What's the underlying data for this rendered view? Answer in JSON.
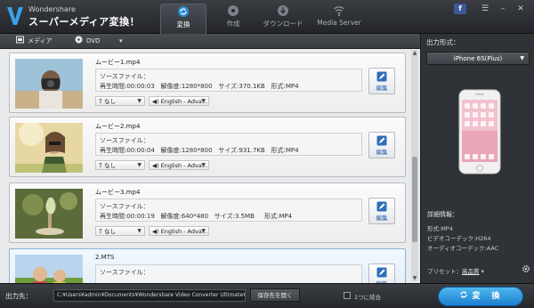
{
  "app": {
    "brand_small": "Wondershare",
    "brand_big": "スーパーメディア変換！"
  },
  "tabs": [
    {
      "label": "変換",
      "icon": "convert-icon",
      "active": true
    },
    {
      "label": "作成",
      "icon": "disc-icon",
      "active": false
    },
    {
      "label": "ダウンロード",
      "icon": "download-icon",
      "active": false
    },
    {
      "label": "Media Server",
      "icon": "wifi-icon",
      "active": false
    }
  ],
  "window": {
    "facebook": "f"
  },
  "toolbar": {
    "add_media": "メディア",
    "add_dvd": "DVD"
  },
  "files": [
    {
      "name": "ムービー1.mp4",
      "source_label": "ソースファイル：",
      "duration": "再生時間:00:00:03",
      "resolution": "解像度:1280*800",
      "size": "サイズ:370.1KB",
      "format": "形式:MP4",
      "subtitle": "なし",
      "audio": "English - Adva...",
      "edit": "編集",
      "selected": false
    },
    {
      "name": "ムービー2.mp4",
      "source_label": "ソースファイル：",
      "duration": "再生時間:00:00:04",
      "resolution": "解像度:1280*800",
      "size": "サイズ:931.7KB",
      "format": "形式:MP4",
      "subtitle": "なし",
      "audio": "English - Adva...",
      "edit": "編集",
      "selected": false
    },
    {
      "name": "ムービー3.mp4",
      "source_label": "ソースファイル：",
      "duration": "再生時間:00:00:19",
      "resolution": "解像度:640*480",
      "size": "サイズ:3.5MB",
      "format": "形式:MP4",
      "subtitle": "なし",
      "audio": "English - Adva...",
      "edit": "編集",
      "selected": false
    },
    {
      "name": "2.MTS",
      "source_label": "ソースファイル：",
      "edit": "編集",
      "selected": true
    }
  ],
  "right_panel": {
    "output_format_label": "出力形式：",
    "device": "iPhone 6S(Plus)",
    "details_label": "詳細情報：",
    "details": [
      "形式:MP4",
      "ビデオコーデック:H264",
      "オーディオコーデック:AAC"
    ],
    "preset_label": "プリセット：",
    "preset_value": "高品質"
  },
  "bottom": {
    "output_label": "出力先：",
    "path": "C:¥Users¥admin¥Documents¥Wondershare Video Converter Ultimate¥Ou",
    "open_folder": "保存先を開く",
    "merge_label": "1つに結合",
    "convert": "変　換"
  },
  "colors": {
    "accent": "#1d7fcf",
    "panel": "#2f3236"
  }
}
